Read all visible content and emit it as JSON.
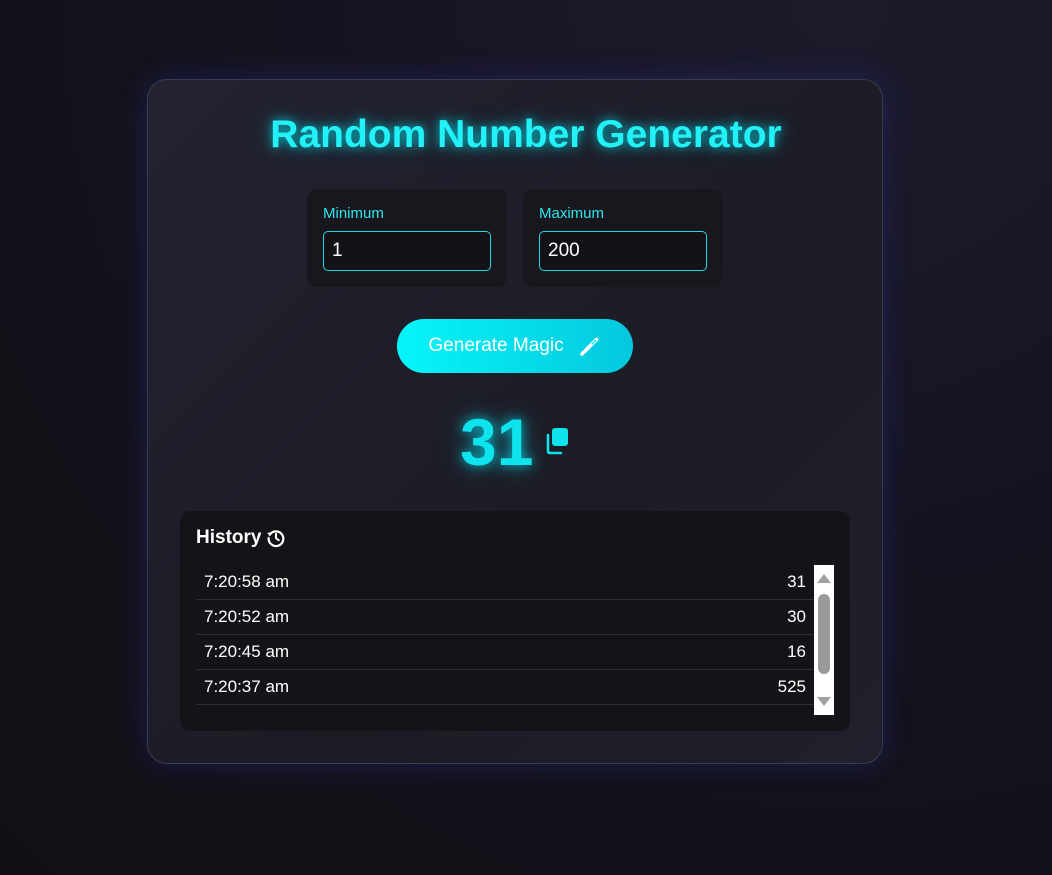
{
  "app": {
    "title": "Random Number Generator"
  },
  "inputs": {
    "minimum": {
      "label": "Minimum",
      "value": "1"
    },
    "maximum": {
      "label": "Maximum",
      "value": "200"
    }
  },
  "generate_button": {
    "label": "Generate Magic",
    "icon": "wand-icon"
  },
  "result": {
    "value": "31",
    "copy_icon": "copy-icon"
  },
  "history": {
    "title": "History",
    "icon": "history-icon",
    "rows": [
      {
        "time": "7:20:58 am",
        "value": "31"
      },
      {
        "time": "7:20:52 am",
        "value": "30"
      },
      {
        "time": "7:20:45 am",
        "value": "16"
      },
      {
        "time": "7:20:37 am",
        "value": "525"
      }
    ]
  },
  "colors": {
    "accent": "#22f2f7",
    "background": "#121218",
    "card": "#1f1f2a"
  }
}
